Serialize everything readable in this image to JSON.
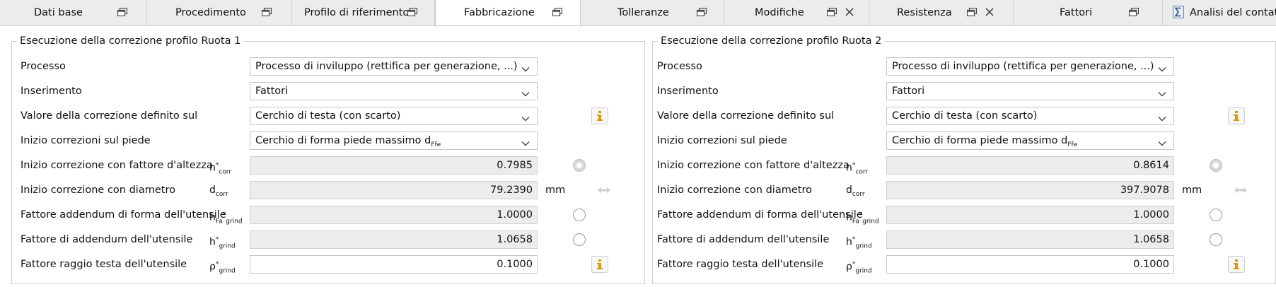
{
  "tabs": [
    {
      "label": "Dati base",
      "has_window_icon": true,
      "has_close": false,
      "active": false
    },
    {
      "label": "Procedimento",
      "has_window_icon": true,
      "has_close": false,
      "active": false
    },
    {
      "label": "Profilo di riferimento",
      "has_window_icon": true,
      "has_close": false,
      "active": false
    },
    {
      "label": "Fabbricazione",
      "has_window_icon": true,
      "has_close": false,
      "active": true
    },
    {
      "label": "Tolleranze",
      "has_window_icon": true,
      "has_close": false,
      "active": false
    },
    {
      "label": "Modifiche",
      "has_window_icon": true,
      "has_close": true,
      "active": false
    },
    {
      "label": "Resistenza",
      "has_window_icon": true,
      "has_close": true,
      "active": false
    },
    {
      "label": "Fattori",
      "has_window_icon": true,
      "has_close": false,
      "active": false
    },
    {
      "label": "Analisi del contatto",
      "has_window_icon": false,
      "has_close": false,
      "active": false,
      "icon": "sigma-icon"
    }
  ],
  "labels": {
    "processo": "Processo",
    "inserimento": "Inserimento",
    "valore": "Valore della correzione definito sul",
    "inizio_piede": "Inizio correzioni sul piede",
    "inizio_altezza": "Inizio correzione con fattore d'altezza",
    "inizio_diametro": "Inizio correzione con diametro",
    "fattore_forma": "Fattore addendum di forma dell'utensile",
    "fattore_addendum": "Fattore di addendum dell'utensile",
    "fattore_raggio": "Fattore raggio testa dell'utensile"
  },
  "symbols": {
    "hcorr": {
      "base": "h",
      "sup": "*",
      "sub": "corr"
    },
    "dcorr": {
      "base": "d",
      "sub": "corr"
    },
    "hfagrind": {
      "base": "h",
      "sub1": "Fa",
      "sup": "*",
      "sub": "grind"
    },
    "hgrind": {
      "base": "h",
      "sup": "*",
      "sub": "grind"
    },
    "rhogrind": {
      "base": "ρ",
      "sup": "*",
      "sub": "grind"
    }
  },
  "unit_mm": "mm",
  "panels": [
    {
      "title": "Esecuzione della correzione profilo Ruota 1",
      "processo": "Processo di inviluppo (rettifica per generazione, ...)",
      "inserimento": "Fattori",
      "valore": "Cerchio di testa (con scarto)",
      "inizio_piede": "Cerchio di forma piede massimo d",
      "inizio_piede_sub": "Ffe",
      "h_corr": "0.7985",
      "d_corr": "79.2390",
      "h_fa_grind": "1.0000",
      "h_grind": "1.0658",
      "rho_grind": "0.1000",
      "radio_selected": "h_corr"
    },
    {
      "title": "Esecuzione della correzione profilo Ruota 2",
      "processo": "Processo di inviluppo (rettifica per generazione, ...)",
      "inserimento": "Fattori",
      "valore": "Cerchio di testa (con scarto)",
      "inizio_piede": "Cerchio di forma piede massimo d",
      "inizio_piede_sub": "Ffe",
      "h_corr": "0.8614",
      "d_corr": "397.9078",
      "h_fa_grind": "1.0000",
      "h_grind": "1.0658",
      "rho_grind": "0.1000",
      "radio_selected": "h_corr"
    }
  ],
  "colors": {
    "info_icon": "#d99a00",
    "tab_bar": "#ececec",
    "readonly_field": "#ececec"
  }
}
